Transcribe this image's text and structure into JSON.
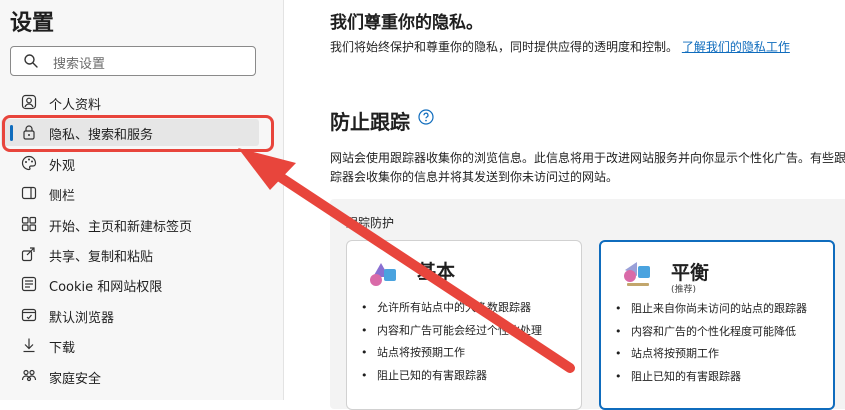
{
  "sidebar": {
    "title": "设置",
    "search_placeholder": "搜索设置",
    "items": [
      {
        "label": "个人资料",
        "icon": "profile-icon"
      },
      {
        "label": "隐私、搜索和服务",
        "icon": "lock-icon",
        "active": true
      },
      {
        "label": "外观",
        "icon": "palette-icon"
      },
      {
        "label": "侧栏",
        "icon": "sidebar-icon"
      },
      {
        "label": "开始、主页和新建标签页",
        "icon": "home-grid-icon"
      },
      {
        "label": "共享、复制和粘贴",
        "icon": "share-icon"
      },
      {
        "label": "Cookie 和网站权限",
        "icon": "cookie-icon"
      },
      {
        "label": "默认浏览器",
        "icon": "browser-icon"
      },
      {
        "label": "下载",
        "icon": "download-icon"
      },
      {
        "label": "家庭安全",
        "icon": "family-icon"
      }
    ]
  },
  "main": {
    "heading": "我们尊重你的隐私。",
    "desc_text": "我们将始终保护和尊重你的隐私，同时提供应得的透明度和控制。",
    "desc_link": "了解我们的隐私工作",
    "tracking": {
      "title": "防止跟踪",
      "desc": "网站会使用跟踪器收集你的浏览信息。此信息将用于改进网站服务并向你显示个性化广告。有些跟踪器会收集你的信息并将其发送到你未访问过的网站。",
      "panel_label": "跟踪防护",
      "cards": [
        {
          "title": "基本",
          "subtitle": "",
          "items": [
            "允许所有站点中的大多数跟踪器",
            "内容和广告可能会经过个性化处理",
            "站点将按预期工作",
            "阻止已知的有害跟踪器"
          ]
        },
        {
          "title": "平衡",
          "subtitle": "(推荐)",
          "items": [
            "阻止来自你尚未访问的站点的跟踪器",
            "内容和广告的个性化程度可能降低",
            "站点将按预期工作",
            "阻止已知的有害跟踪器"
          ]
        }
      ]
    }
  },
  "colors": {
    "accent": "#0f6cbd",
    "annotation": "#e8453c"
  }
}
